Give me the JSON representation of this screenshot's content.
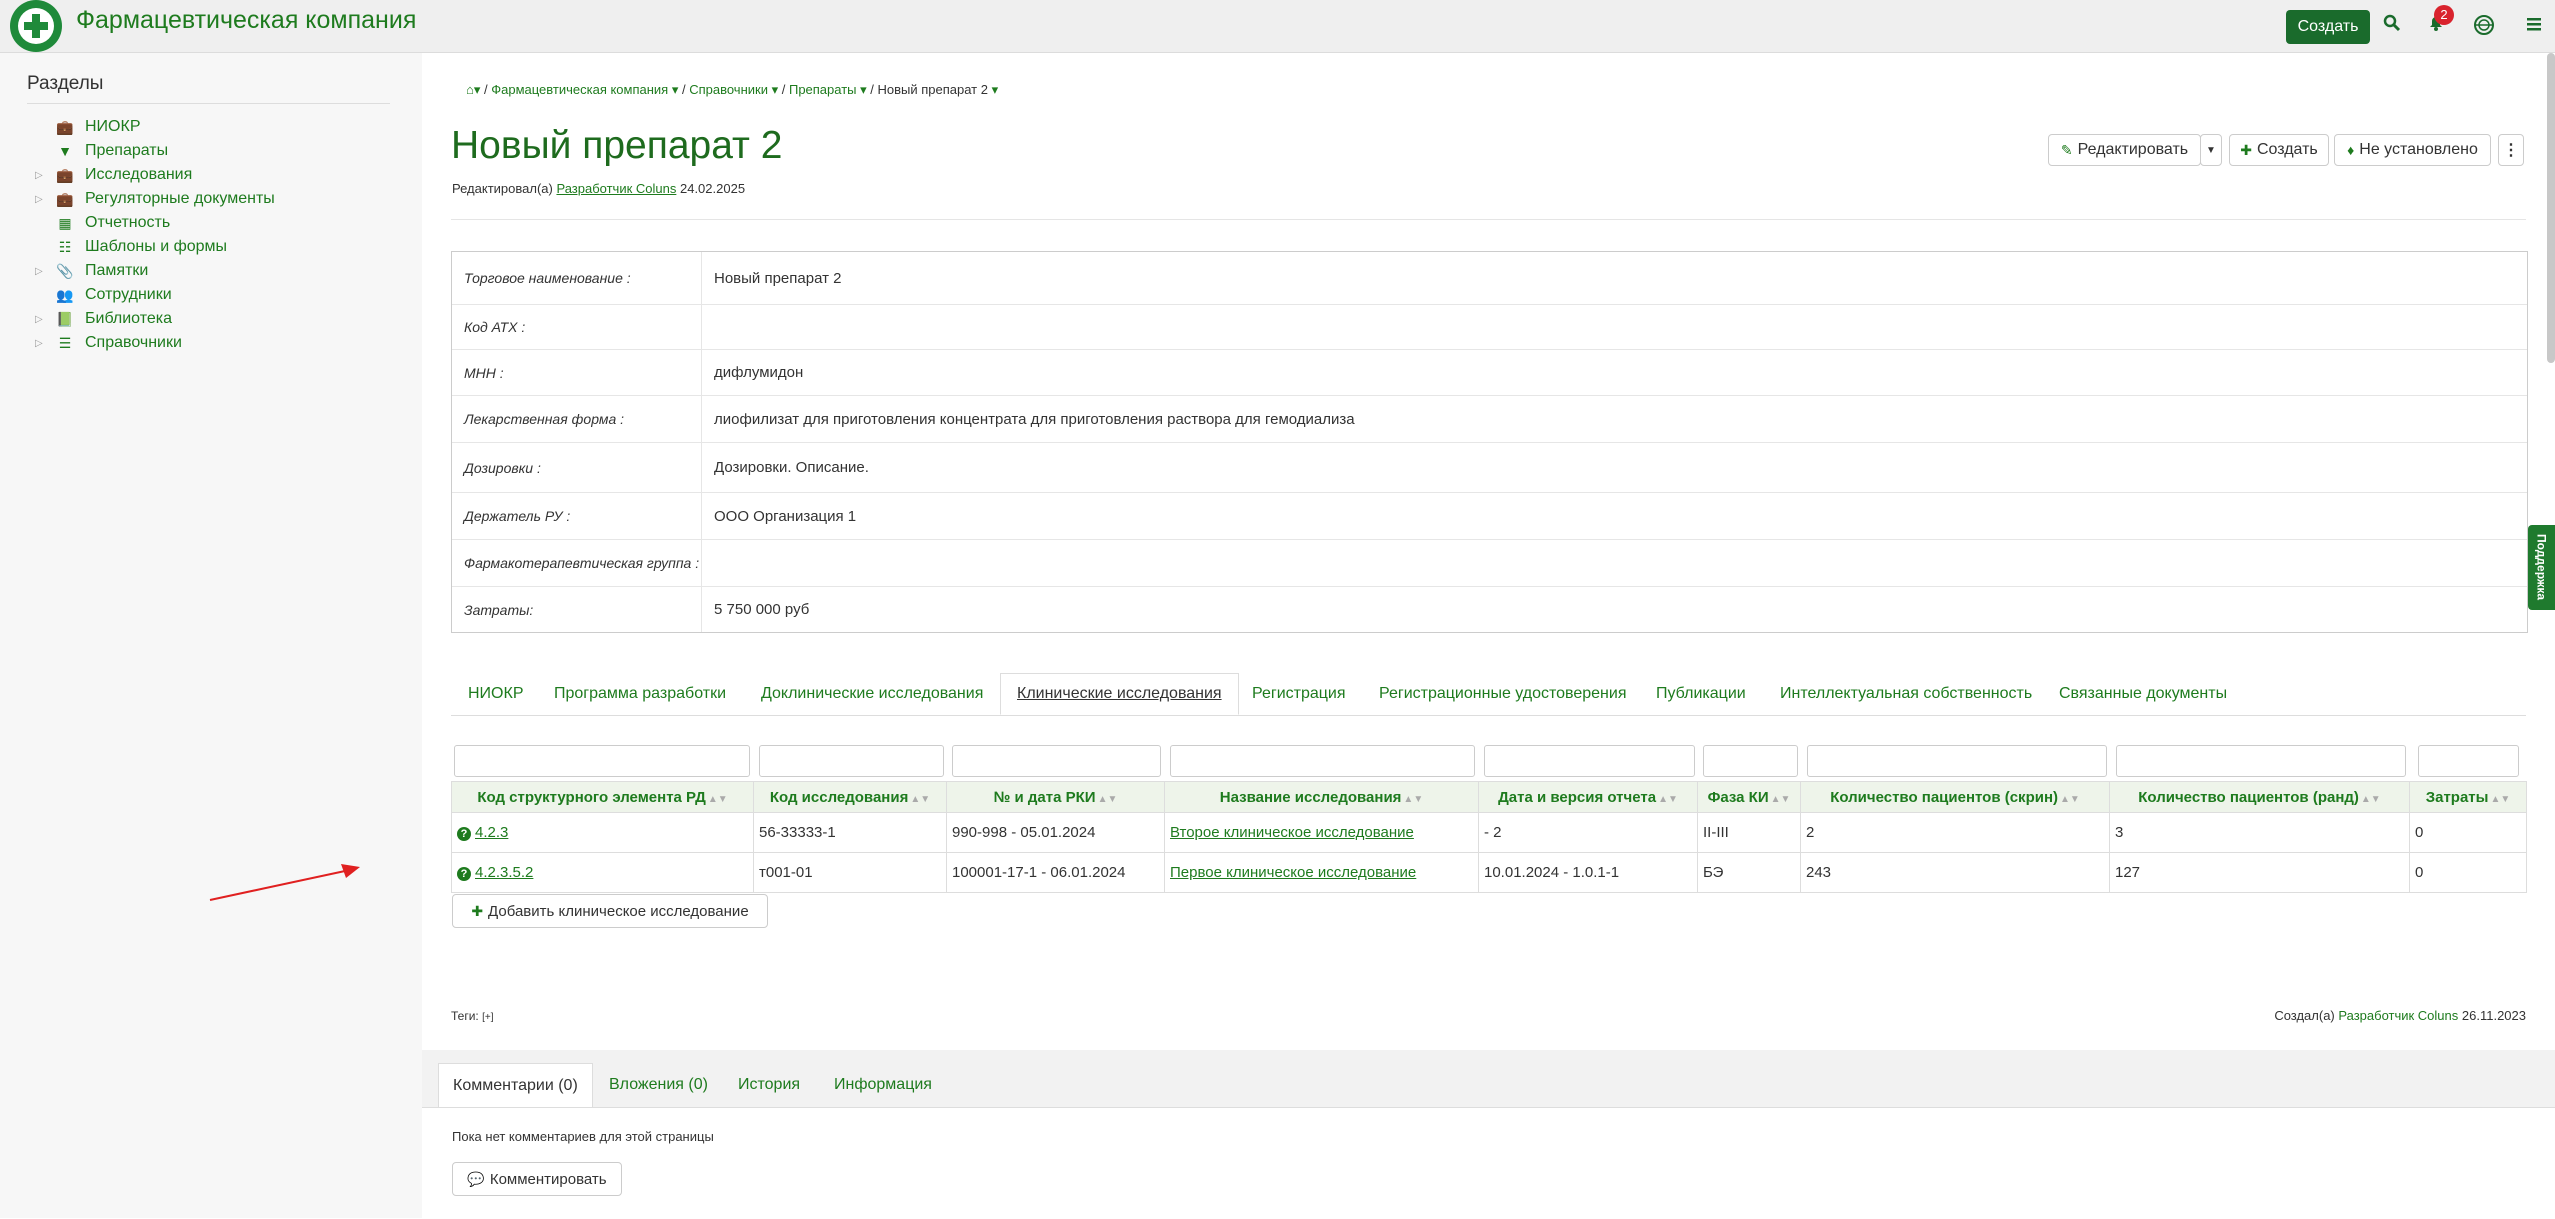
{
  "app": {
    "title": "Фармацевтическая компания",
    "create_label": "Создать",
    "notif_count": "2"
  },
  "sidebar": {
    "title": "Разделы",
    "items": [
      {
        "label": "НИОКР",
        "icon": "briefcase-icon",
        "expandable": false
      },
      {
        "label": "Препараты",
        "icon": "filter-icon",
        "expandable": false
      },
      {
        "label": "Исследования",
        "icon": "briefcase-icon",
        "expandable": true
      },
      {
        "label": "Регуляторные документы",
        "icon": "briefcase-icon",
        "expandable": true
      },
      {
        "label": "Отчетность",
        "icon": "table-icon",
        "expandable": false
      },
      {
        "label": "Шаблоны и формы",
        "icon": "database-icon",
        "expandable": false
      },
      {
        "label": "Памятки",
        "icon": "paperclip-icon",
        "expandable": true
      },
      {
        "label": "Сотрудники",
        "icon": "users-icon",
        "expandable": false
      },
      {
        "label": "Библиотека",
        "icon": "book-icon",
        "expandable": true
      },
      {
        "label": "Справочники",
        "icon": "list-icon",
        "expandable": true
      }
    ]
  },
  "breadcrumb": {
    "items": [
      "Фармацевтическая компания",
      "Справочники",
      "Препараты"
    ],
    "current": "Новый препарат 2"
  },
  "page": {
    "title": "Новый препарат 2",
    "edited_prefix": "Редактировал(а)",
    "edited_user": "Разработчик Coluns",
    "edited_date": "24.02.2025"
  },
  "actions": {
    "edit": "Редактировать",
    "create": "Создать",
    "status": "Не установлено"
  },
  "properties": [
    {
      "label": "Торговое наименование :",
      "value": "Новый препарат 2"
    },
    {
      "label": "Код АТХ :",
      "value": ""
    },
    {
      "label": "МНН :",
      "value": "дифлумидон"
    },
    {
      "label": "Лекарственная форма :",
      "value": "лиофилизат для приготовления концентрата для приготовления раствора для гемодиализа"
    },
    {
      "label": "Дозировки :",
      "value": "Дозировки. Описание."
    },
    {
      "label": "Держатель РУ :",
      "value": "ООО Организация 1"
    },
    {
      "label": "Фармакотерапевтическая группа :",
      "value": ""
    },
    {
      "label": "Затраты:",
      "value": "5 750 000 руб"
    }
  ],
  "tabs": [
    "НИОКР",
    "Программа разработки",
    "Доклинические исследования",
    "Клинические исследования",
    "Регистрация",
    "Регистрационные удостоверения",
    "Публикации",
    "Интеллектуальная собственность",
    "Связанные документы"
  ],
  "active_tab": "Клинические исследования",
  "table": {
    "headers": [
      "Код структурного элемента РД",
      "Код исследования",
      "№ и дата РКИ",
      "Название исследования",
      "Дата и версия отчета",
      "Фаза КИ",
      "Количество пациентов (скрин)",
      "Количество пациентов (ранд)",
      "Затраты"
    ],
    "rows": [
      [
        "4.2.3",
        "56-33333-1",
        "990-998 - 05.01.2024",
        "Второе клиническое исследование",
        "- 2",
        "II-III",
        "2",
        "3",
        "0"
      ],
      [
        "4.2.3.5.2",
        "т001-01",
        "100001-17-1 - 06.01.2024",
        "Первое клиническое исследование",
        "10.01.2024 - 1.0.1-1",
        "БЭ",
        "243",
        "127",
        "0"
      ]
    ],
    "add_label": "Добавить клиническое исследование"
  },
  "footer": {
    "tags_label": "Теги:",
    "tags_add": "[+]",
    "created_prefix": "Создал(а)",
    "created_user": "Разработчик Coluns",
    "created_date": "26.11.2023"
  },
  "bottom_tabs": [
    "Комментарии (0)",
    "Вложения (0)",
    "История",
    "Информация"
  ],
  "comments": {
    "empty_text": "Пока нет комментариев для этой страницы",
    "button": "Комментировать"
  },
  "support_label": "Поддержка",
  "colors": {
    "accent": "#1e7b1e",
    "button_dark": "#1a6b2c",
    "badge": "#d9232d"
  }
}
